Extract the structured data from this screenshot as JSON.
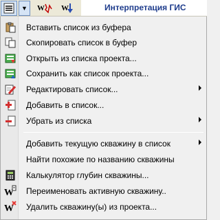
{
  "toolbar": {
    "title": "Интерпретация ГИС",
    "w1_label": "W",
    "w2_label": "W"
  },
  "menu": {
    "items": [
      {
        "label": "Вставить список из буфера",
        "icon": "paste-icon"
      },
      {
        "label": "Скопировать список в буфер",
        "icon": "copy-icon"
      },
      {
        "label": "Открыть из списка проекта...",
        "icon": "open-list-icon"
      },
      {
        "label": "Сохранить как список проекта...",
        "icon": "save-list-icon"
      },
      {
        "label": "Редактировать список...",
        "icon": "edit-list-icon",
        "submenu": true
      },
      {
        "label": "Добавить в список...",
        "icon": "add-to-list-icon"
      },
      {
        "label": "Убрать из списка",
        "icon": "remove-from-list-icon",
        "submenu": true
      },
      {
        "label": "Добавить текущую скважину в список",
        "submenu": true
      },
      {
        "label": "Найти похожие по названию скважины"
      },
      {
        "label": "Калькулятор глубин скважины...",
        "icon": "calculator-icon"
      },
      {
        "label": "Переименовать активную скважину..",
        "icon": "rename-well-icon"
      },
      {
        "label": "Удалить скважину(ы) из проекта...",
        "icon": "delete-well-icon"
      }
    ]
  }
}
